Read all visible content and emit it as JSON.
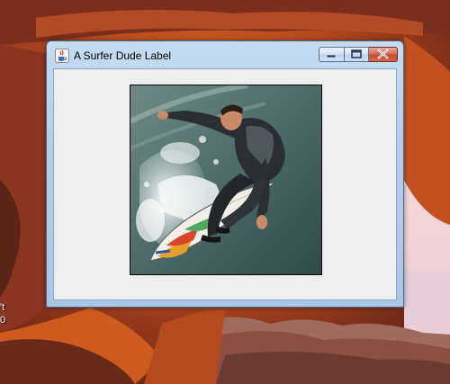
{
  "window": {
    "title": "A Surfer Dude Label",
    "app_icon": "java-cup-icon"
  },
  "caption_buttons": {
    "minimize_icon": "minimize-icon",
    "maximize_icon": "maximize-icon",
    "close_icon": "close-icon"
  },
  "desktop": {
    "icon_label_fragment": "'t\n0"
  },
  "colors": {
    "client_background": "#eeeeee",
    "titlebar": "#b9d1ea",
    "close_button": "#c9503a"
  }
}
